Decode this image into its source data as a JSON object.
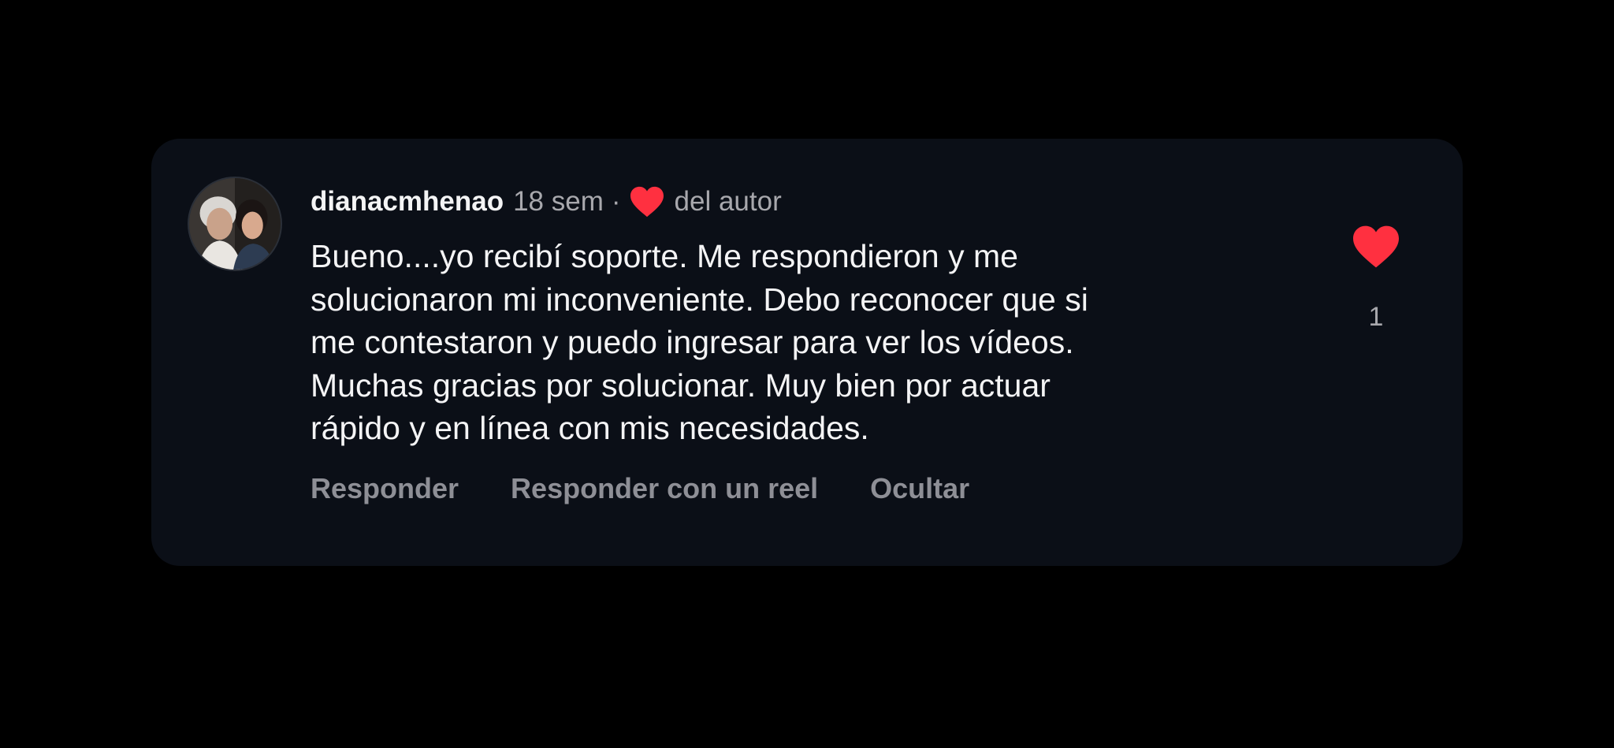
{
  "comment": {
    "username": "dianacmhenao",
    "time": "18 sem",
    "separator": "·",
    "author_label": "del autor",
    "text": "Bueno....yo recibí soporte. Me respondieron y me\nsolucionaron mi inconveniente. Debo reconocer que  si\nme contestaron y puedo ingresar para ver los vídeos.\nMuchas gracias por solucionar. Muy bien por actuar\nrápido y en línea con mis necesidades.",
    "like_count": "1"
  },
  "actions": {
    "reply": "Responder",
    "reply_with_reel": "Responder con un reel",
    "hide": "Ocultar"
  },
  "icons": {
    "author_like": "heart-icon",
    "like": "heart-icon"
  },
  "colors": {
    "background": "#000000",
    "card": "#0b0f17",
    "heart": "#ff3040",
    "text_primary": "#f4f4f5",
    "text_secondary": "#a8a8ad",
    "action_text": "#8e8f96"
  }
}
